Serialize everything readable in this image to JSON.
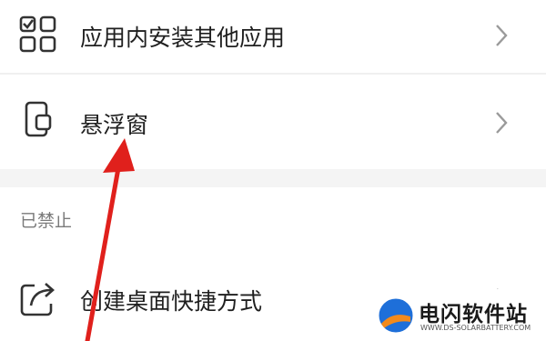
{
  "menu": {
    "items": [
      {
        "label": "应用内安装其他应用",
        "icon": "apps-grid-icon"
      },
      {
        "label": "悬浮窗",
        "icon": "floating-window-phone-icon"
      }
    ]
  },
  "disabled_section": {
    "header": "已禁止",
    "items": [
      {
        "label": "创建桌面快捷方式",
        "icon": "share-shortcut-icon"
      }
    ]
  },
  "annotation": {
    "arrow_color": "#e0201c"
  },
  "watermark": {
    "title": "电闪软件站",
    "subtitle": "WWW.DS-SOLARBATTERY.COM",
    "colors": {
      "blue": "#1e6fd9",
      "orange": "#f28a1c"
    }
  }
}
